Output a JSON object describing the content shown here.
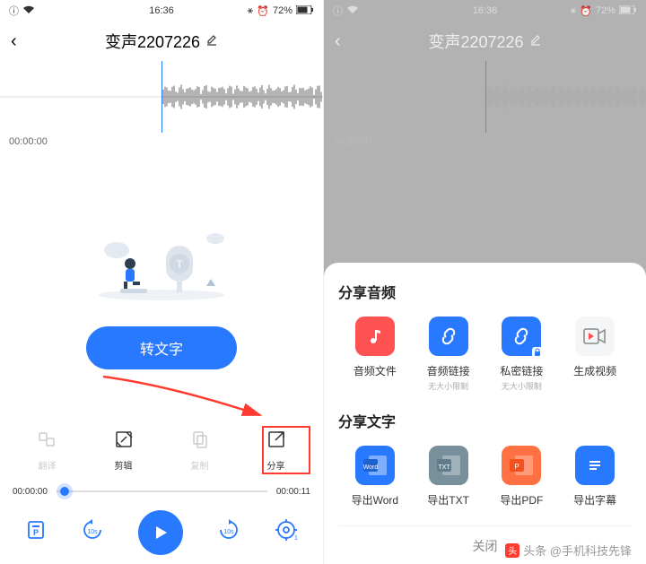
{
  "status": {
    "time": "16:36",
    "battery": "72%",
    "bt_alarm_bell": "✱ 𝄞"
  },
  "title": "变声2207226",
  "timestamp": "00:00:00",
  "transcribe": "转文字",
  "tools": {
    "translate": "翻译",
    "trim": "剪辑",
    "copy": "复制",
    "share": "分享"
  },
  "progress": {
    "current": "00:00:00",
    "total": "00:00:11"
  },
  "skip": "10s",
  "speed": "1x",
  "sheet": {
    "audio_title": "分享音频",
    "text_title": "分享文字",
    "close": "关闭",
    "nosize": "无大小限制",
    "items_audio": {
      "file": "音频文件",
      "link": "音频链接",
      "private": "私密链接",
      "video": "生成视频"
    },
    "items_text": {
      "word": "导出Word",
      "txt": "导出TXT",
      "pdf": "导出PDF",
      "sub": "导出字幕"
    }
  },
  "watermark": "头条 @手机科技先锋",
  "colors": {
    "primary": "#2979ff",
    "red": "#ff5252",
    "orange": "#ff7043",
    "blue2": "#29b6f6",
    "grey": "#78909c"
  }
}
